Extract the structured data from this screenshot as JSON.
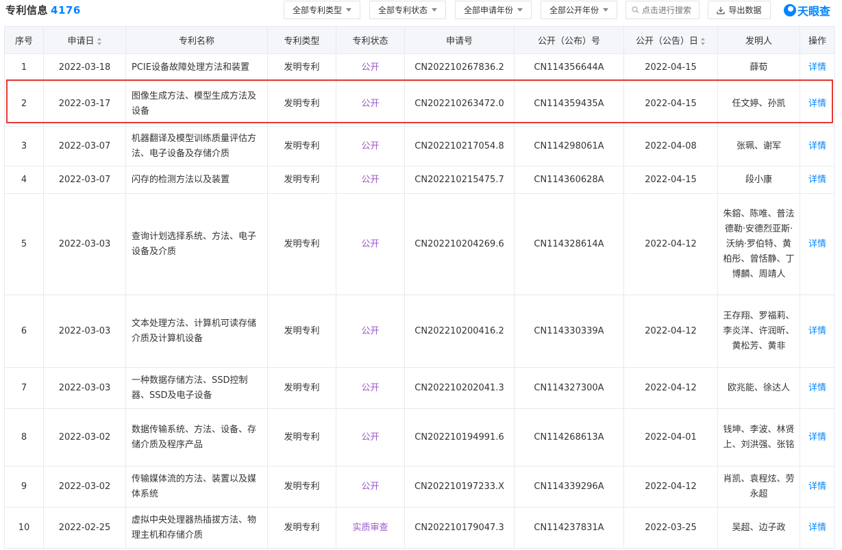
{
  "header": {
    "title": "专利信息",
    "count": "4176",
    "filters": [
      {
        "label": "全部专利类型"
      },
      {
        "label": "全部专利状态"
      },
      {
        "label": "全部申请年份"
      },
      {
        "label": "全部公开年份"
      }
    ],
    "search_placeholder": "点击进行搜索",
    "export_label": "导出数据",
    "brand": "天眼查"
  },
  "colors": {
    "accent": "#0084ff",
    "status_text": "#9a55c9",
    "highlight_border": "#e53935",
    "header_bg": "#f4f6fa"
  },
  "table": {
    "columns": [
      "序号",
      "申请日",
      "专利名称",
      "专利类型",
      "专利状态",
      "申请号",
      "公开（公布）号",
      "公开（公告）日",
      "发明人",
      "操作"
    ],
    "rows": [
      {
        "no": "1",
        "apply_date": "2022-03-18",
        "name": "PCIE设备故障处理方法和装置",
        "type": "发明专利",
        "status": "公开",
        "apply_no": "CN202210267836.2",
        "pub_no": "CN114356644A",
        "pub_date": "2022-04-15",
        "inventors": "薛荀",
        "op": "详情"
      },
      {
        "no": "2",
        "apply_date": "2022-03-17",
        "name": "图像生成方法、模型生成方法及设备",
        "type": "发明专利",
        "status": "公开",
        "apply_no": "CN202210263472.0",
        "pub_no": "CN114359435A",
        "pub_date": "2022-04-15",
        "inventors": "任文婷、孙凯",
        "op": "详情"
      },
      {
        "no": "3",
        "apply_date": "2022-03-07",
        "name": "机器翻译及模型训练质量评估方法、电子设备及存储介质",
        "type": "发明专利",
        "status": "公开",
        "apply_no": "CN202210217054.8",
        "pub_no": "CN114298061A",
        "pub_date": "2022-04-08",
        "inventors": "张珮、谢军",
        "op": "详情"
      },
      {
        "no": "4",
        "apply_date": "2022-03-07",
        "name": "闪存的检测方法以及装置",
        "type": "发明专利",
        "status": "公开",
        "apply_no": "CN202210215475.7",
        "pub_no": "CN114360628A",
        "pub_date": "2022-04-15",
        "inventors": "段小康",
        "op": "详情"
      },
      {
        "no": "5",
        "apply_date": "2022-03-03",
        "name": "查询计划选择系统、方法、电子设备及介质",
        "type": "发明专利",
        "status": "公开",
        "apply_no": "CN202210204269.6",
        "pub_no": "CN114328614A",
        "pub_date": "2022-04-12",
        "inventors": "朱鎔、陈唯、普法德勒·安德烈亚斯·沃纳·罗伯特、黄柏彤、曾恬静、丁博麟、周靖人",
        "op": "详情"
      },
      {
        "no": "6",
        "apply_date": "2022-03-03",
        "name": "文本处理方法、计算机可读存储介质及计算机设备",
        "type": "发明专利",
        "status": "公开",
        "apply_no": "CN202210200416.2",
        "pub_no": "CN114330339A",
        "pub_date": "2022-04-12",
        "inventors": "王存翔、罗福莉、李炎洋、许润昕、黄松芳、黄非",
        "op": "详情"
      },
      {
        "no": "7",
        "apply_date": "2022-03-03",
        "name": "一种数据存储方法、SSD控制器、SSD及电子设备",
        "type": "发明专利",
        "status": "公开",
        "apply_no": "CN202210202041.3",
        "pub_no": "CN114327300A",
        "pub_date": "2022-04-12",
        "inventors": "欧兆能、徐达人",
        "op": "详情"
      },
      {
        "no": "8",
        "apply_date": "2022-03-02",
        "name": "数据传输系统、方法、设备、存储介质及程序产品",
        "type": "发明专利",
        "status": "公开",
        "apply_no": "CN202210194991.6",
        "pub_no": "CN114268613A",
        "pub_date": "2022-04-01",
        "inventors": "钱坤、李波、林贤上、刘洪强、张铭",
        "op": "详情"
      },
      {
        "no": "9",
        "apply_date": "2022-03-02",
        "name": "传输媒体流的方法、装置以及媒体系统",
        "type": "发明专利",
        "status": "公开",
        "apply_no": "CN202210197233.X",
        "pub_no": "CN114339296A",
        "pub_date": "2022-04-12",
        "inventors": "肖凯、袁程炫、劳永超",
        "op": "详情"
      },
      {
        "no": "10",
        "apply_date": "2022-02-25",
        "name": "虚拟中央处理器热插拔方法、物理主机和存储介质",
        "type": "发明专利",
        "status": "实质审查",
        "apply_no": "CN202210179047.3",
        "pub_no": "CN114237831A",
        "pub_date": "2022-03-25",
        "inventors": "吴超、边子政",
        "op": "详情"
      }
    ]
  }
}
